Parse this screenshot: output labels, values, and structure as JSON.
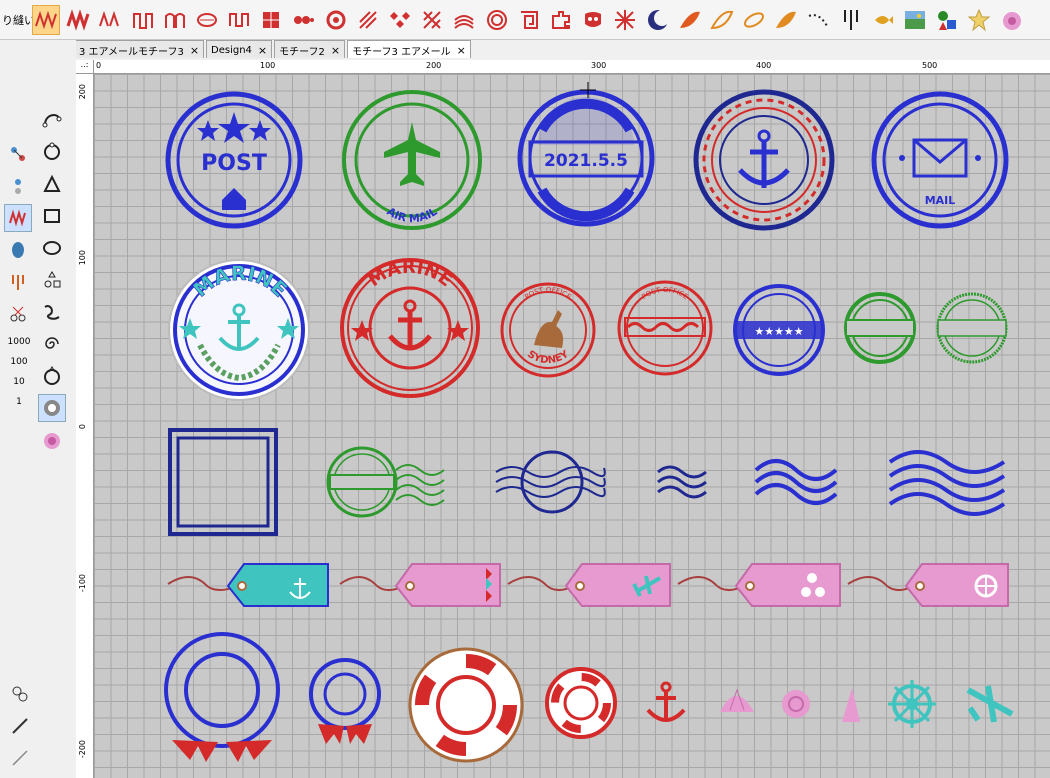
{
  "toolbar": {
    "label": "り縫い:",
    "buttons": [
      "zigzag-stitch",
      "bold-zigzag-stitch",
      "wave-stitch",
      "square-wave-stitch",
      "arch-stitch",
      "oval-chain-stitch",
      "square-chain-stitch",
      "grid-pattern",
      "bead-chain",
      "circle-flower",
      "cross-hatch",
      "diamond-pattern",
      "x-pattern",
      "arc-lines",
      "concentric-circles",
      "square-spiral",
      "puzzle-pattern",
      "mask-pattern",
      "lattice-pattern",
      "moon-icon",
      "leaf-fill",
      "leaf-outline",
      "leaf-outline-2",
      "leaf-filled-2",
      "dotted-curve",
      "fork-stitch",
      "fish-icon",
      "landscape-image",
      "shapes-icon",
      "star-icon",
      "pink-shell"
    ]
  },
  "tabs": [
    {
      "label": "3 エアメールモチーフ3",
      "close": "×"
    },
    {
      "label": "Design4",
      "close": "×"
    },
    {
      "label": "モチーフ2",
      "close": "×"
    },
    {
      "label": "モチーフ3 エアメール",
      "close": "×"
    }
  ],
  "left_numbers": [
    "1000",
    "100",
    "10",
    "1"
  ],
  "hruler": {
    "labels": [
      "0",
      "100",
      "200",
      "300",
      "400",
      "500"
    ]
  },
  "vruler": {
    "labels": [
      "200",
      "100",
      "0",
      "-100",
      "-200"
    ]
  },
  "corner": "..:",
  "stamps": {
    "post_text": "POST",
    "airmail_text": "AIR MAIL",
    "date_text": "2021.5.5",
    "mail_text": "MAIL",
    "marine_text": "MARINE",
    "post_office_text": "POST OFFICE",
    "sydney_text": "SYDNEY"
  },
  "colors": {
    "blue": "#2a2fd0",
    "green": "#2e9a2e",
    "red": "#d42a2a",
    "navy": "#1e2890",
    "teal": "#3fc4bf",
    "pink": "#e79ad0",
    "brown": "#a86a3a",
    "canvas": "#c9c9c9",
    "grid": "#a8a8a8",
    "toolbar_active": "#ffd58a"
  }
}
